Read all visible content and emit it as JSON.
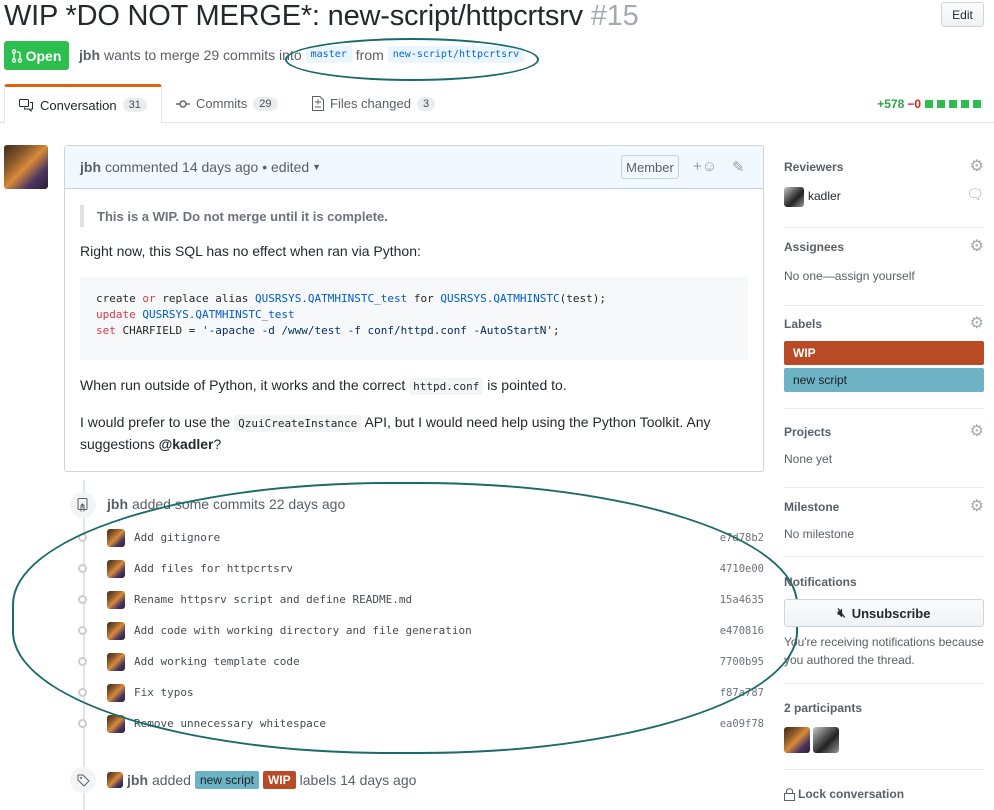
{
  "header": {
    "title": "WIP *DO NOT MERGE*: new-script/httpcrtsrv",
    "number": "#15",
    "edit_label": "Edit",
    "state_label": "Open",
    "author": "jbh",
    "merge_text": "wants to merge 29 commits into",
    "base_branch": "master",
    "from_text": "from",
    "head_branch": "new-script/httpcrtsrv"
  },
  "tabs": [
    {
      "label": "Conversation",
      "count": "31",
      "icon": "comment-discussion-icon"
    },
    {
      "label": "Commits",
      "count": "29",
      "icon": "git-commit-icon"
    },
    {
      "label": "Files changed",
      "count": "3",
      "icon": "file-diff-icon"
    }
  ],
  "diffstat": {
    "additions": "+578",
    "deletions": "−0"
  },
  "comment": {
    "author": "jbh",
    "meta": "commented 14 days ago • edited",
    "badge": "Member",
    "quote": "This is a WIP. Do not merge until it is complete.",
    "para1": "Right now, this SQL has no effect when ran via Python:",
    "code": {
      "l1_a": "create ",
      "l1_b": "or",
      "l1_c": " replace alias ",
      "l1_d": "QUSRSYS.QATMHINSTC_test",
      "l1_e": " for ",
      "l1_f": "QUSRSYS.QATMHINSTC",
      "l1_g": "(test);",
      "l2_a": "update ",
      "l2_b": "QUSRSYS.QATMHINSTC_test",
      "l3_a": "set",
      "l3_b": " CHARFIELD = ",
      "l3_c": "'-apache -d /www/test -f conf/httpd.conf -AutoStartN'",
      "l3_d": ";"
    },
    "para2_a": "When run outside of Python, it works and the correct",
    "para2_code": "httpd.conf",
    "para2_b": "is pointed to.",
    "para3_a": "I would prefer to use the",
    "para3_code": "QzuiCreateInstance",
    "para3_b": "API, but I would need help using the Python Toolkit. Any",
    "para3_c": "suggestions",
    "para3_mention": "@kadler",
    "para3_d": "?"
  },
  "timeline": {
    "commits_event": {
      "author": "jbh",
      "text": "added some commits 22 days ago"
    },
    "commits": [
      {
        "message": "Add gitignore",
        "sha": "e7d78b2"
      },
      {
        "message": "Add files for httpcrtsrv",
        "sha": "4710e00"
      },
      {
        "message": "Rename httpsrv script and define README.md",
        "sha": "15a4635"
      },
      {
        "message": "Add code with working directory and file generation",
        "sha": "e470816"
      },
      {
        "message": "Add working template code",
        "sha": "7700b95"
      },
      {
        "message": "Fix typos",
        "sha": "f87a787"
      },
      {
        "message": "Remove unnecessary whitespace",
        "sha": "ea09f78"
      }
    ],
    "labels_event": {
      "author": "jbh",
      "verb": "added",
      "label1": "new script",
      "label2": "WIP",
      "suffix": "labels 14 days ago"
    }
  },
  "sidebar": {
    "reviewers": {
      "heading": "Reviewers",
      "name": "kadler"
    },
    "assignees": {
      "heading": "Assignees",
      "text": "No one—assign yourself"
    },
    "labels": {
      "heading": "Labels",
      "items": [
        {
          "name": "WIP",
          "color": "#b94a26"
        },
        {
          "name": "new script",
          "color": "#6db3c5"
        }
      ]
    },
    "projects": {
      "heading": "Projects",
      "text": "None yet"
    },
    "milestone": {
      "heading": "Milestone",
      "text": "No milestone"
    },
    "notifications": {
      "heading": "Notifications",
      "button": "Unsubscribe",
      "reason_1": "You're receiving notifications because",
      "reason_2": "you authored the thread."
    },
    "participants": {
      "heading": "2 participants"
    },
    "lock": {
      "label": "Lock conversation"
    }
  },
  "colors": {
    "open_green": "#2cbe4e",
    "annotation": "#1a6b6b",
    "tab_accent": "#e36209"
  }
}
